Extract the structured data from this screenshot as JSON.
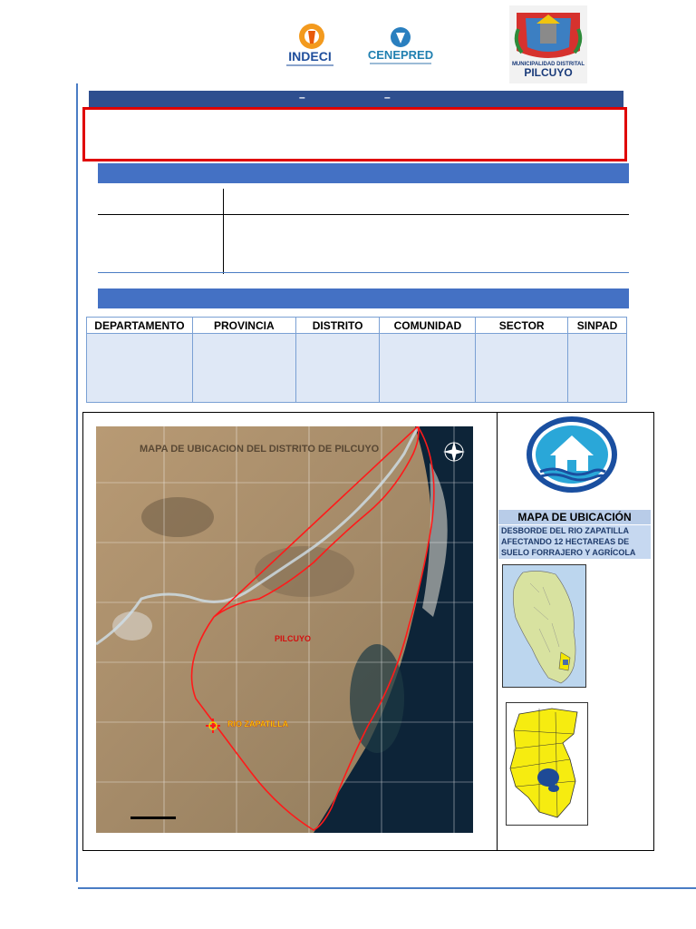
{
  "header": {
    "logo_indeci": "INDECI",
    "logo_cenepred": "CENEPRED",
    "logo_muni_line1": "MUNICIPALIDAD DISTRITAL",
    "logo_muni_line2": "PILCUYO"
  },
  "title_bar": {
    "dash1": "–",
    "dash2": "–"
  },
  "location_table": {
    "headers": [
      "DEPARTAMENTO",
      "PROVINCIA",
      "DISTRITO",
      "COMUNIDAD",
      "SECTOR",
      "SINPAD"
    ]
  },
  "map": {
    "title": "MAPA DE UBICACION DEL DISTRITO DE PILCUYO",
    "label_district": "PILCUYO",
    "label_river": "RIO ZAPATILLA"
  },
  "sidebar": {
    "mapa_title": "MAPA DE UBICACIÓN",
    "description": "DESBORDE DEL RIO ZAPATILLA AFECTANDO 12 HECTAREAS DE SUELO FORRAJERO Y AGRÍCOLA"
  },
  "colors": {
    "title_bar": "#2f4f8f",
    "section_bar": "#4471c4",
    "alert_border": "#e00000",
    "table_fill": "#dfe8f6"
  }
}
